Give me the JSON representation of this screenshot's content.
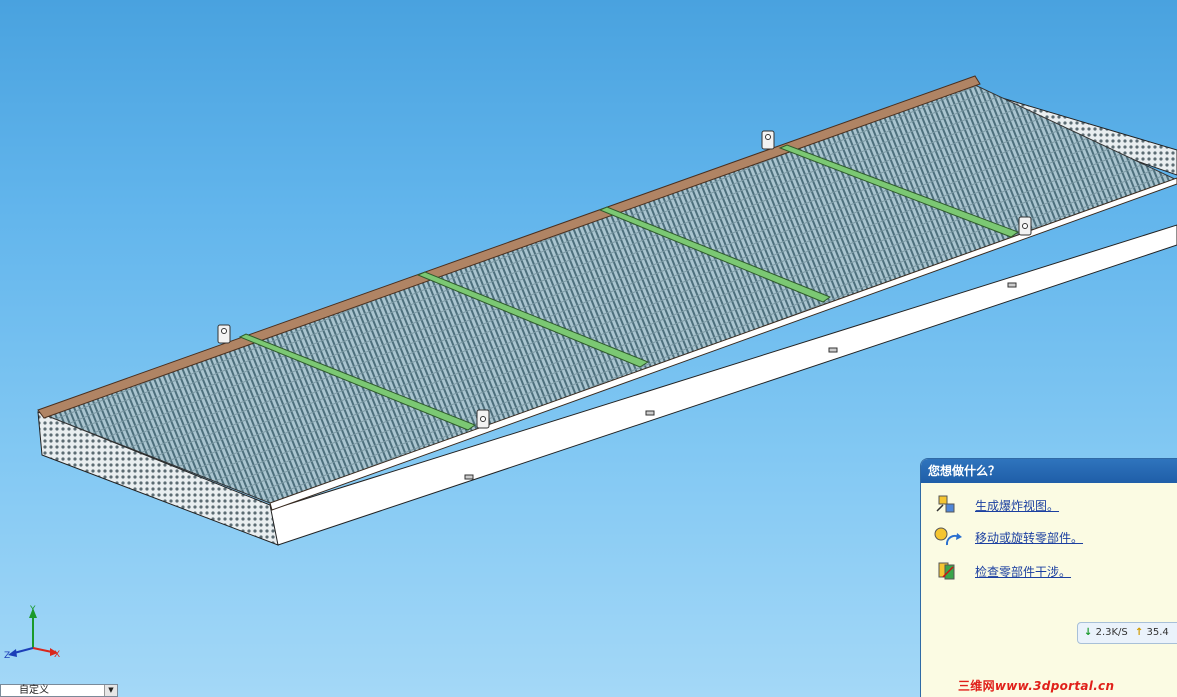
{
  "task_panel": {
    "title": "您想做什么？",
    "items": [
      {
        "label": "生成爆炸视图。",
        "icon": "explode-view-icon"
      },
      {
        "label": "移动或旋转零部件。",
        "icon": "move-rotate-component-icon"
      },
      {
        "label": "检查零部件干涉。",
        "icon": "interference-check-icon"
      }
    ]
  },
  "network_speed": {
    "download": "2.3K/S",
    "upload": "35.4"
  },
  "watermark": {
    "cn": "三维网",
    "url": "www.3dportal.cn"
  },
  "triad": {
    "x": "X",
    "y": "Y",
    "z": "Z"
  },
  "view_selector": {
    "value": "自定义"
  },
  "colors": {
    "background_top": "#49a2df",
    "background_bottom": "#a4d8f7",
    "grating": "#9bb8c4",
    "crossbar": "#7bc873",
    "frame_rail": "#a67a5a",
    "panel_header": "#1f5ea8",
    "link": "#1b3fa0"
  }
}
